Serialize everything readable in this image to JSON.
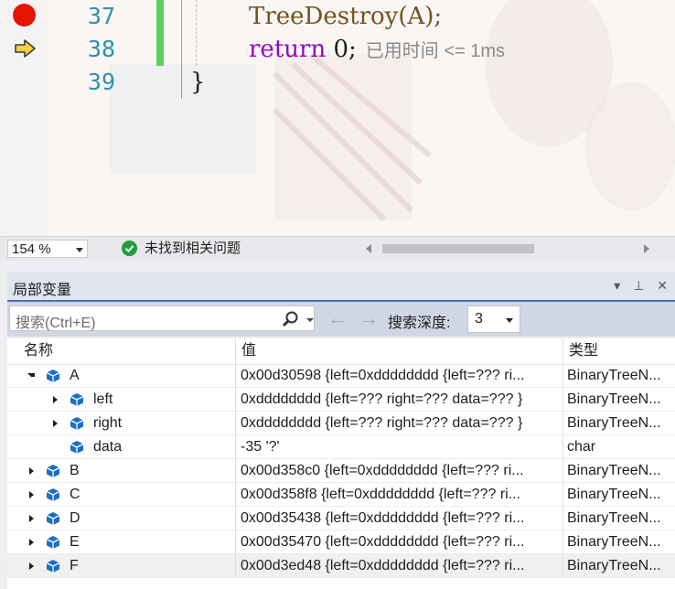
{
  "editor": {
    "lines": [
      {
        "number": "37",
        "code": "TreeDestroy(A);",
        "marker": "breakpoint"
      },
      {
        "number": "38",
        "keyword": "return",
        "rest": " 0;",
        "marker": "current-statement",
        "perf_tip": "已用时间 <= 1ms"
      },
      {
        "number": "39",
        "code": "}"
      }
    ],
    "colors": {
      "line_number": "#2b91af",
      "keyword": "#8f08c4",
      "function": "#74531f",
      "breakpoint": "#e51400",
      "change_bar": "#5bd05b"
    }
  },
  "status": {
    "zoom": "154 %",
    "issues_text": "未找到相关问题"
  },
  "locals": {
    "title": "局部变量",
    "search_placeholder": "搜索(Ctrl+E)",
    "depth_label": "搜索深度:",
    "depth_value": "3",
    "columns": {
      "name": "名称",
      "value": "值",
      "type": "类型"
    },
    "rows": [
      {
        "name": "A",
        "value": "0x00d30598 {left=0xdddddddd {left=??? ri...",
        "type": "BinaryTreeN...",
        "indent": 0,
        "expander": "open"
      },
      {
        "name": "left",
        "value": "0xdddddddd {left=??? right=??? data=??? }",
        "type": "BinaryTreeN...",
        "indent": 1,
        "expander": "closed"
      },
      {
        "name": "right",
        "value": "0xdddddddd {left=??? right=??? data=??? }",
        "type": "BinaryTreeN...",
        "indent": 1,
        "expander": "closed"
      },
      {
        "name": "data",
        "value": "-35 '?'",
        "type": "char",
        "indent": 1,
        "expander": "none"
      },
      {
        "name": "B",
        "value": "0x00d358c0 {left=0xdddddddd {left=??? ri...",
        "type": "BinaryTreeN...",
        "indent": 0,
        "expander": "closed"
      },
      {
        "name": "C",
        "value": "0x00d358f8 {left=0xdddddddd {left=??? ri...",
        "type": "BinaryTreeN...",
        "indent": 0,
        "expander": "closed"
      },
      {
        "name": "D",
        "value": "0x00d35438 {left=0xdddddddd {left=??? ri...",
        "type": "BinaryTreeN...",
        "indent": 0,
        "expander": "closed"
      },
      {
        "name": "E",
        "value": "0x00d35470 {left=0xdddddddd {left=??? ri...",
        "type": "BinaryTreeN...",
        "indent": 0,
        "expander": "closed"
      },
      {
        "name": "F",
        "value": "0x00d3ed48 {left=0xdddddddd {left=??? ri...",
        "type": "BinaryTreeN...",
        "indent": 0,
        "expander": "closed",
        "selected": true
      }
    ]
  }
}
